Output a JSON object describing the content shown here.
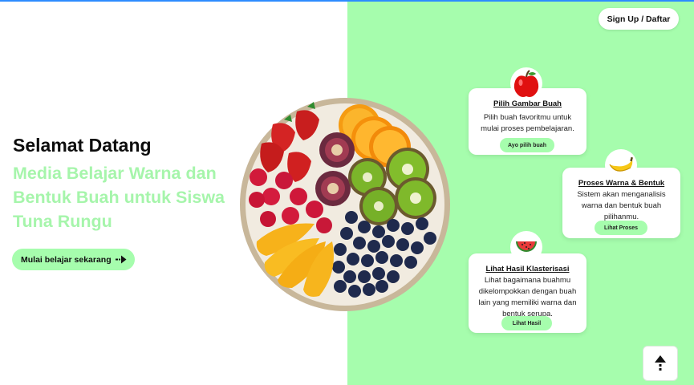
{
  "header": {
    "signup_label": "Sign Up / Daftar"
  },
  "hero": {
    "title": "Selamat Datang",
    "subtitle": "Media Belajar Warna dan Bentuk Buah untuk Siswa Tuna Rungu",
    "cta_label": "Mulai belajar sekarang"
  },
  "cards": [
    {
      "title": "Pilih Gambar Buah",
      "description": "Pilih buah favoritmu untuk mulai proses pembelajaran.",
      "button": "Ayo pilih buah",
      "icon": "apple-icon"
    },
    {
      "title": "Proses Warna & Bentuk",
      "description": "Sistem akan menganalisis warna dan bentuk buah pilihanmu.",
      "button": "Lihat Proses",
      "icon": "banana-icon"
    },
    {
      "title": "Lihat Hasil Klasterisasi",
      "description": "Lihat bagaimana buahmu dikelompokkan dengan buah lain yang memiliki warna dan bentuk serupa.",
      "button": "Lihat Hasil",
      "icon": "watermelon-icon"
    }
  ],
  "colors": {
    "accent_green": "#a6fdad",
    "subtitle_green": "#a6f5ab",
    "top_line": "#2d8cff"
  }
}
